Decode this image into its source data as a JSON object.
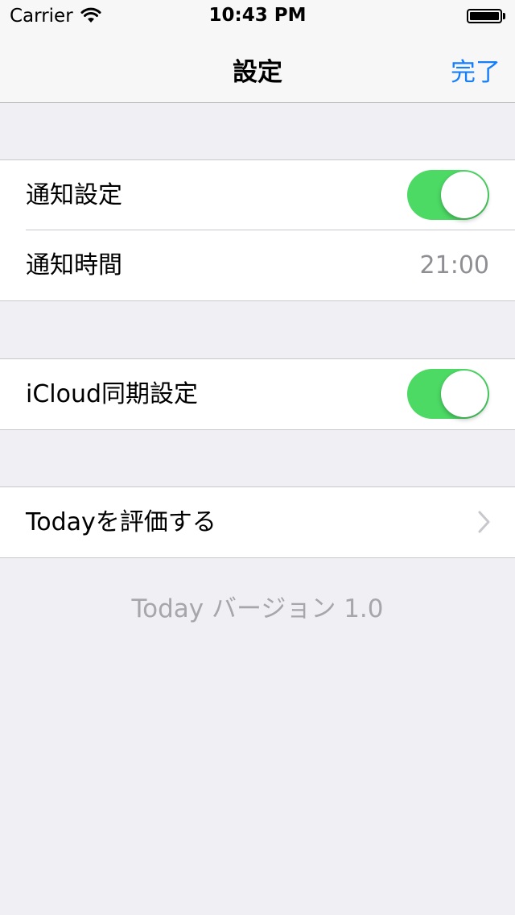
{
  "status_bar": {
    "carrier": "Carrier",
    "time": "10:43 PM"
  },
  "nav": {
    "title": "設定",
    "done_label": "完了",
    "accent_color": "#157efb"
  },
  "sections": {
    "notifications": {
      "notify_label": "通知設定",
      "notify_on": true,
      "time_label": "通知時間",
      "time_value": "21:00"
    },
    "sync": {
      "icloud_label": "iCloud同期設定",
      "icloud_on": true
    },
    "rate": {
      "rate_label": "Todayを評価する"
    }
  },
  "footer": {
    "version_text": "Today バージョン 1.0"
  },
  "colors": {
    "switch_on": "#4cd964",
    "background": "#efeff4"
  }
}
